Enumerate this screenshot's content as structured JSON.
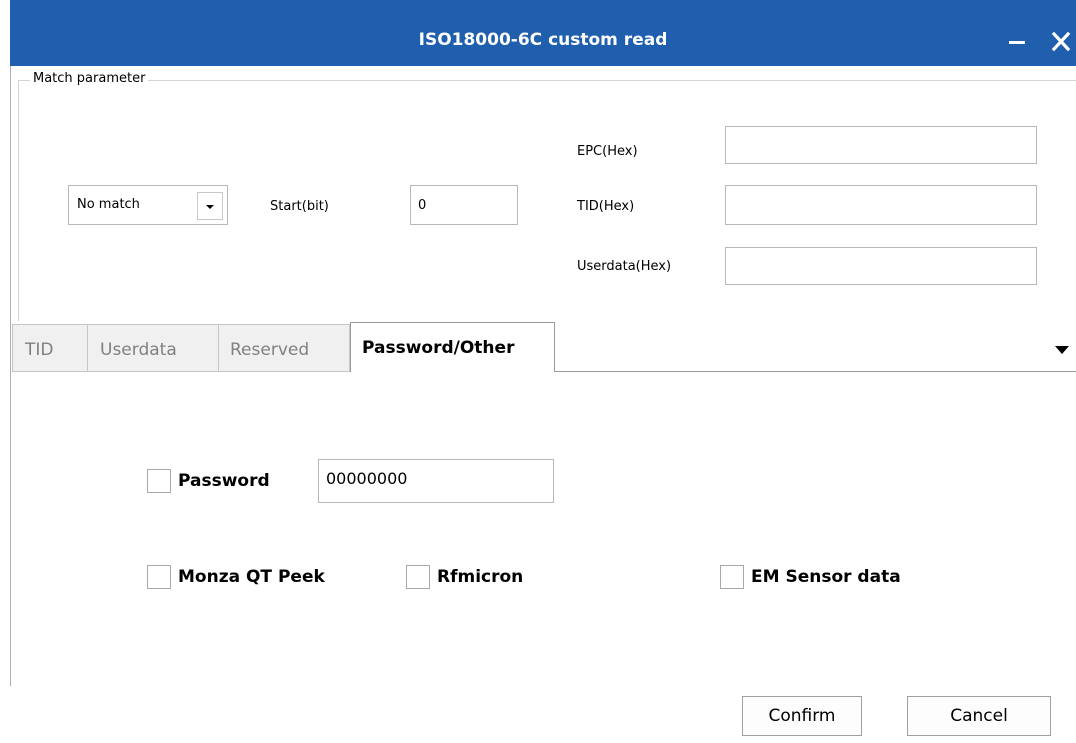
{
  "window": {
    "title": "ISO18000-6C custom read"
  },
  "colors": {
    "titlebar": "#1f5fae",
    "title_text": "#ffffff"
  },
  "icons": {
    "minimize": "minimize-icon",
    "close": "close-icon",
    "dropdown": "chevron-down-icon"
  },
  "match": {
    "group_label": "Match parameter",
    "mode_select": {
      "value": "No match"
    },
    "start_label": "Start(bit)",
    "start_value": "0",
    "epc_label": "EPC(Hex)",
    "epc_value": "",
    "tid_label": "TID(Hex)",
    "tid_value": "",
    "userdata_label": "Userdata(Hex)",
    "userdata_value": ""
  },
  "tabs": [
    {
      "label": "TID",
      "active": false
    },
    {
      "label": "Userdata",
      "active": false
    },
    {
      "label": "Reserved",
      "active": false
    },
    {
      "label": "Password/Other",
      "active": true
    }
  ],
  "options": {
    "password_label": "Password",
    "password_checked": false,
    "password_value": "00000000",
    "monza_label": "Monza QT Peek",
    "monza_checked": false,
    "rfmicron_label": "Rfmicron",
    "rfmicron_checked": false,
    "em_label": "EM Sensor data",
    "em_checked": false
  },
  "buttons": {
    "confirm": "Confirm",
    "cancel": "Cancel"
  }
}
